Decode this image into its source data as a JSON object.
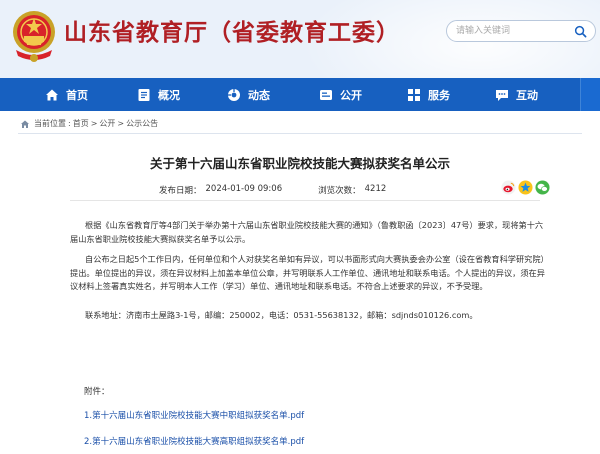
{
  "header": {
    "site_title": "山东省教育厅（省委教育工委）",
    "search_placeholder": "请输入关键词"
  },
  "nav": {
    "items": [
      {
        "label": "首页",
        "icon": "home-icon"
      },
      {
        "label": "概况",
        "icon": "document-icon"
      },
      {
        "label": "动态",
        "icon": "dynamics-icon"
      },
      {
        "label": "公开",
        "icon": "public-icon"
      },
      {
        "label": "服务",
        "icon": "service-icon"
      },
      {
        "label": "互动",
        "icon": "chat-icon"
      }
    ]
  },
  "breadcrumb": {
    "current_label": "当前位置",
    "items": [
      "首页",
      "公开",
      "公示公告"
    ]
  },
  "article": {
    "title": "关于第十六届山东省职业院校技能大赛拟获奖名单公示",
    "publish_label": "发布日期：",
    "publish_date": "2024-01-09 09:06",
    "views_label": "浏览次数：",
    "views": "4212",
    "paragraphs": [
      "根据《山东省教育厅等4部门关于举办第十六届山东省职业院校技能大赛的通知》（鲁教职函〔2023〕47号）要求，现将第十六届山东省职业院校技能大赛拟获奖名单予以公示。",
      "自公布之日起5个工作日内，任何单位和个人对获奖名单如有异议，可以书面形式向大赛执委会办公室（设在省教育科学研究院）提出。单位提出的异议，须在异议材料上加盖本单位公章，并写明联系人工作单位、通讯地址和联系电话。个人提出的异议，须在异议材料上签署真实姓名，并写明本人工作（学习）单位、通讯地址和联系电话。不符合上述要求的异议，不予受理。",
      "联系地址：济南市土屋路3-1号，邮编：250002，电话：0531-55638132，邮箱：sdjnds010126.com。"
    ],
    "attachments_label": "附件：",
    "attachments": [
      "1.第十六届山东省职业院校技能大赛中职组拟获奖名单.pdf",
      "2.第十六届山东省职业院校技能大赛高职组拟获奖名单.pdf"
    ]
  },
  "colors": {
    "brand_red": "#b01f24",
    "nav_blue": "#1760c0",
    "link_blue": "#1a4fa8"
  }
}
